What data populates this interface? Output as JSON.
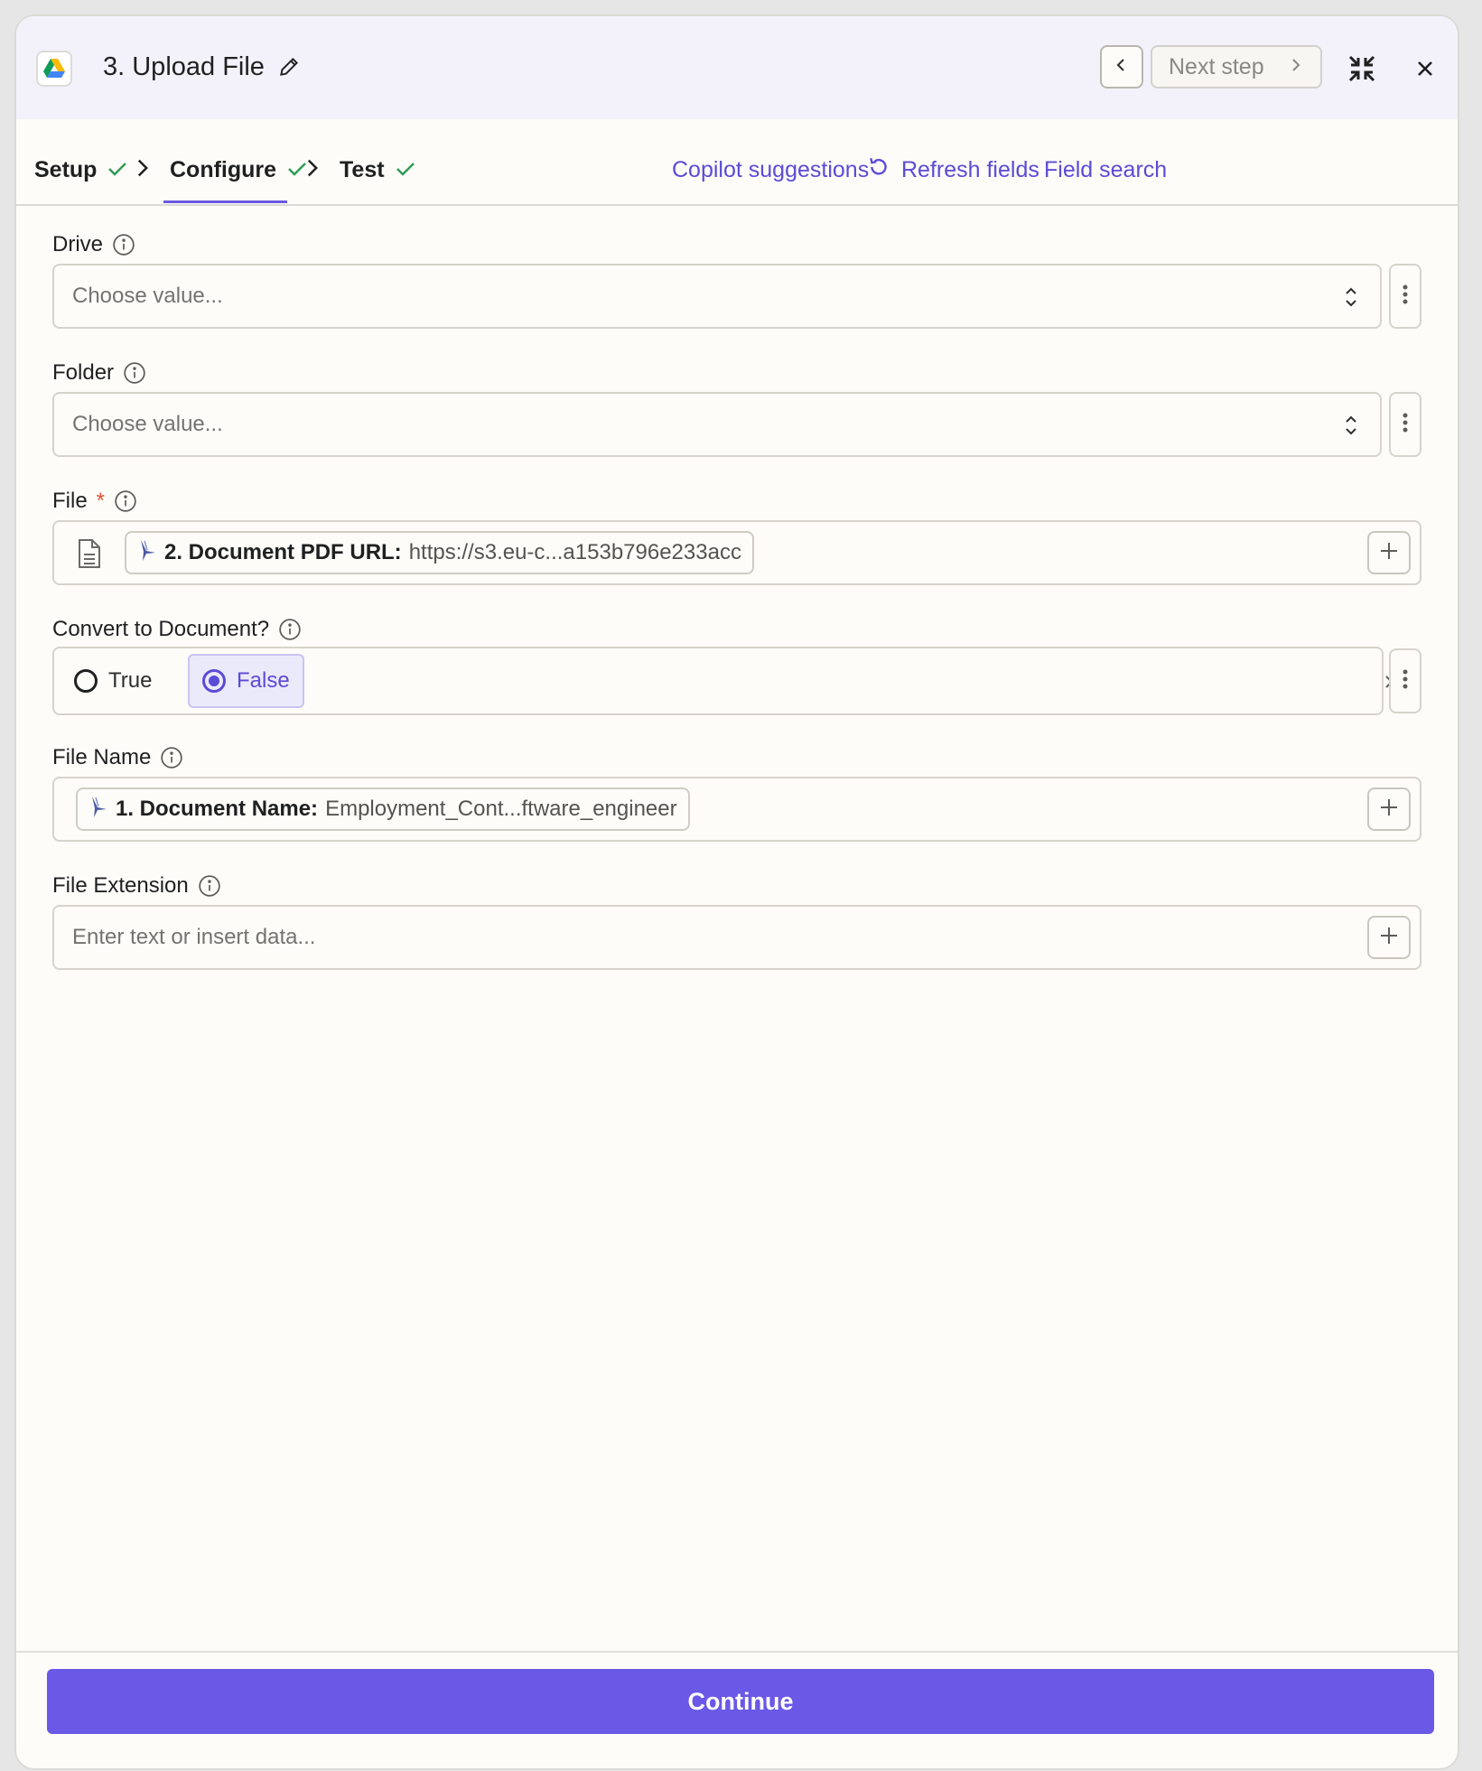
{
  "header": {
    "title": "3. Upload File",
    "next_step_label": "Next step",
    "app_icon": "google-drive-icon"
  },
  "tabs": [
    {
      "label": "Setup",
      "done": true
    },
    {
      "label": "Configure",
      "done": true,
      "active": true
    },
    {
      "label": "Test",
      "done": true
    }
  ],
  "actions": {
    "copilot": "Copilot suggestions",
    "refresh": "Refresh fields",
    "field_search": "Field search"
  },
  "fields": {
    "drive": {
      "label": "Drive",
      "placeholder": "Choose value..."
    },
    "folder": {
      "label": "Folder",
      "placeholder": "Choose value..."
    },
    "file": {
      "label": "File",
      "required_mark": "*",
      "pill_key": "2. Document PDF URL:",
      "pill_value": "https://s3.eu-c...a153b796e233acc"
    },
    "convert": {
      "label": "Convert to Document?",
      "options": [
        "True",
        "False"
      ],
      "selected": "False"
    },
    "file_name": {
      "label": "File Name",
      "pill_key": "1. Document Name:",
      "pill_value": "Employment_Cont...ftware_engineer"
    },
    "file_extension": {
      "label": "File Extension",
      "placeholder": "Enter text or insert data..."
    }
  },
  "footer": {
    "continue_label": "Continue"
  },
  "colors": {
    "accent": "#6a58e6",
    "link": "#5b4bd6",
    "check": "#2e9b53",
    "required": "#e0552c"
  }
}
